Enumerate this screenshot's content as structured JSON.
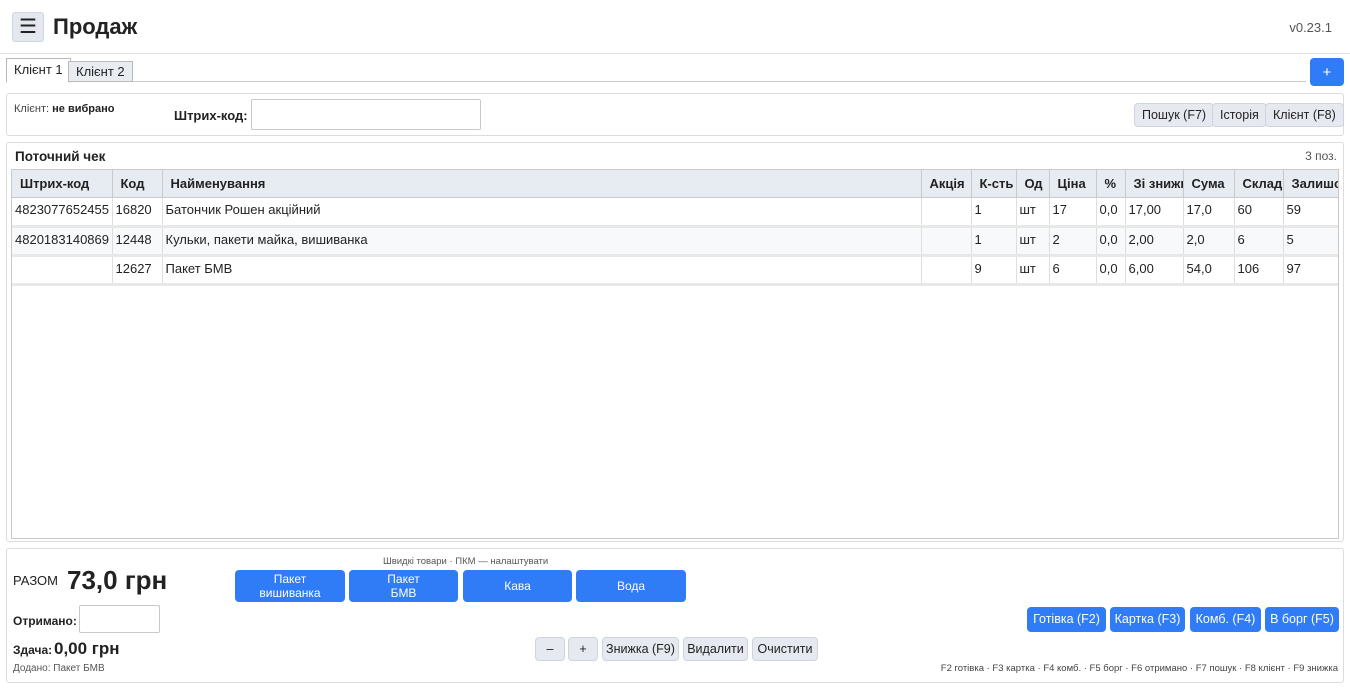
{
  "header": {
    "menu_glyph": "☰",
    "title": "Продаж",
    "version": "v0.23.1"
  },
  "tabs": [
    {
      "label": "Клієнт 1",
      "active": true
    },
    {
      "label": "Клієнт 2",
      "active": false
    }
  ],
  "add_tab_label": "+",
  "client": {
    "prefix": "Клієнт:",
    "value": "не вибрано",
    "barcode_label": "Штрих-код:",
    "barcode_value": "",
    "buttons": {
      "search": "Пошук (F7)",
      "history": "Історія",
      "client": "Клієнт (F8)"
    }
  },
  "receipt": {
    "title": "Поточний чек",
    "count": "3 поз.",
    "columns": [
      "Штрих-код",
      "Код",
      "Найменування",
      "Акція",
      "К-сть",
      "Од",
      "Ціна",
      "%",
      "Зі знижкою",
      "Сума",
      "Склад",
      "Залишок"
    ],
    "rows": [
      [
        "4823077652455",
        "16820",
        "Батончик Рошен акційний",
        "",
        "1",
        "шт",
        "17",
        "0,0",
        "17,00",
        "17,0",
        "60",
        "59"
      ],
      [
        "4820183140869",
        "12448",
        "Кульки, пакети майка, вишиванка",
        "",
        "1",
        "шт",
        "2",
        "0,0",
        "2,00",
        "2,0",
        "6",
        "5"
      ],
      [
        "",
        "12627",
        "Пакет БМВ",
        "",
        "9",
        "шт",
        "6",
        "0,0",
        "6,00",
        "54,0",
        "106",
        "97"
      ]
    ]
  },
  "summary": {
    "total_label": "РАЗОМ",
    "total_value": "73,0 грн",
    "quick_hint": "Швидкі товари · ПКМ — налаштувати",
    "quick_items": [
      "Пакет\nвишиванка",
      "Пакет\nБМВ",
      "Кава",
      "Вода"
    ],
    "received_label": "Отримано:",
    "received_value": "",
    "change_label": "Здача:",
    "change_value": "0,00 грн",
    "added_text": "Додано: Пакет БМВ",
    "payment_buttons": {
      "cash": "Готівка (F2)",
      "card": "Картка (F3)",
      "combo": "Комб. (F4)",
      "debt": "В борг (F5)"
    },
    "action_buttons": {
      "minus": "–",
      "plus": "+",
      "discount": "Знижка (F9)",
      "delete": "Видалити",
      "clear": "Очистити"
    },
    "shortcuts": "F2 готівка · F3 картка · F4 комб. · F5 борг · F6 отримано · F7 пошук · F8 клієнт · F9 знижка"
  },
  "colors": {
    "accent": "#2f7cf6",
    "header_bg": "#e7ebf2"
  }
}
